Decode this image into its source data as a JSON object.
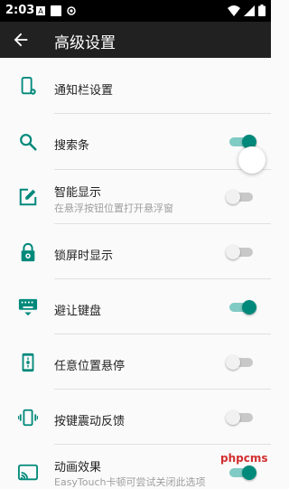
{
  "status_bar": {
    "time": "2:03",
    "left_icons": [
      "notification-a-icon",
      "square-app-icon",
      "record-icon"
    ],
    "right_icons": [
      "wifi-icon",
      "signal-icon",
      "battery-icon"
    ]
  },
  "app_bar": {
    "title": "高级设置",
    "back_icon": "arrow-left-icon"
  },
  "accent_color": "#00897b",
  "items": [
    {
      "icon": "phone-gear-icon",
      "title": "通知栏设置",
      "subtitle": "",
      "toggle": null
    },
    {
      "icon": "search-icon",
      "title": "搜索条",
      "subtitle": "",
      "toggle": true
    },
    {
      "icon": "edit-window-icon",
      "title": "智能显示",
      "subtitle": "在悬浮按钮位置打开悬浮窗",
      "toggle": false
    },
    {
      "icon": "lock-icon",
      "title": "锁屏时显示",
      "subtitle": "",
      "toggle": false
    },
    {
      "icon": "keyboard-icon",
      "title": "避让键盘",
      "subtitle": "",
      "toggle": true
    },
    {
      "icon": "phone-position-icon",
      "title": "任意位置悬停",
      "subtitle": "",
      "toggle": false
    },
    {
      "icon": "vibration-icon",
      "title": "按键震动反馈",
      "subtitle": "",
      "toggle": false
    },
    {
      "icon": "cast-icon",
      "title": "动画效果",
      "subtitle": "EasyTouch卡顿可尝试关闭此选项",
      "toggle": true
    }
  ],
  "watermark": "phpcms"
}
